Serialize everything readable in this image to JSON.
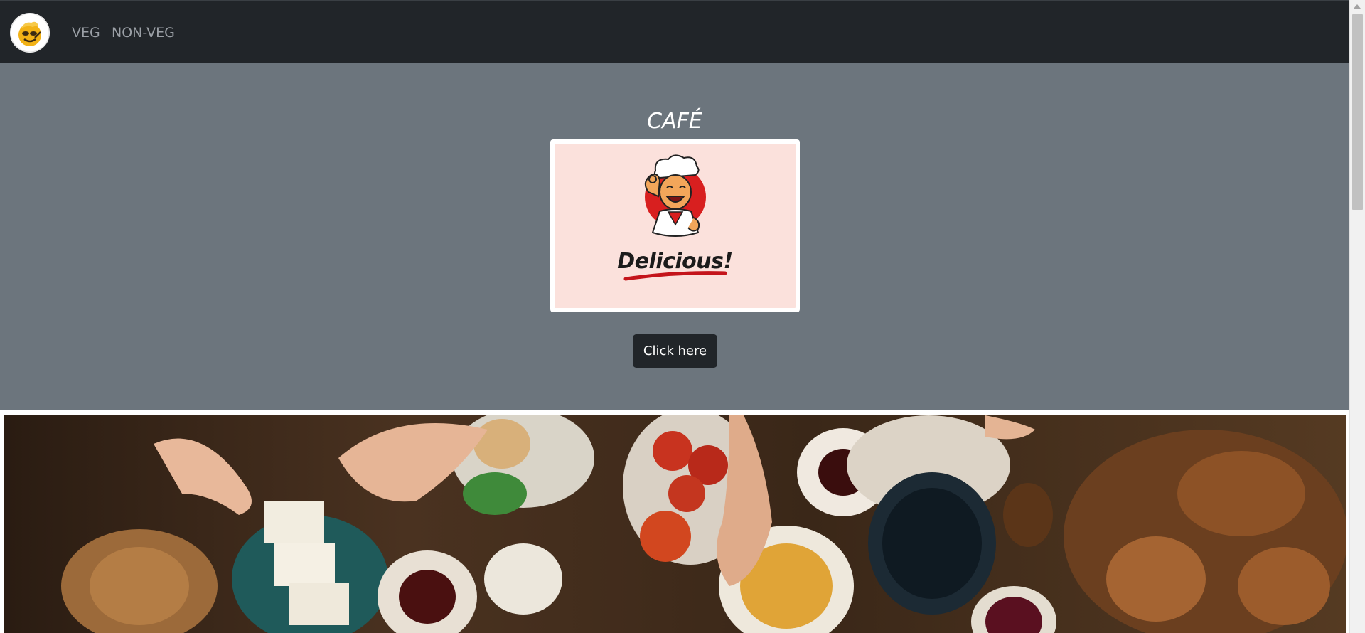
{
  "navbar": {
    "brand_icon": "chef-logo-icon",
    "links": [
      {
        "label": "VEG"
      },
      {
        "label": "NON-VEG"
      }
    ]
  },
  "hero": {
    "title": "CAFÉ",
    "logo_icon": "chef-mascot-icon",
    "logo_text": "Delicious!",
    "button_label": "Click here"
  },
  "banner": {
    "image": "food-table-photo"
  },
  "colors": {
    "navbar_bg": "#212529",
    "hero_bg": "#6c757d",
    "button_bg": "#212529",
    "logo_bg": "#fbe1dc",
    "accent_red": "#d81f1f"
  }
}
